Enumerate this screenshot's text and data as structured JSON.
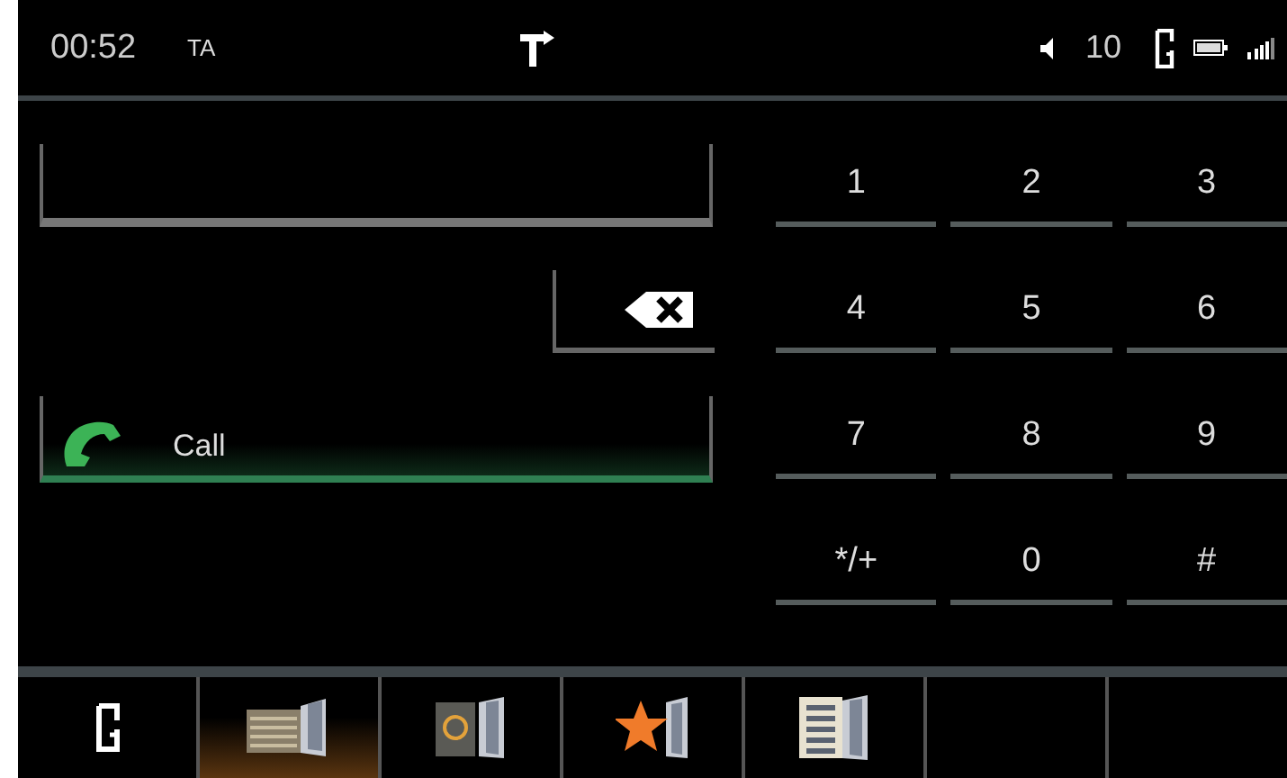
{
  "status_bar": {
    "time": "00:52",
    "traffic": "TA",
    "volume": "10"
  },
  "dialer": {
    "call_button": {
      "label": "Call"
    }
  },
  "keypad": [
    {
      "label": "1"
    },
    {
      "label": "2"
    },
    {
      "label": "3"
    },
    {
      "label": "4"
    },
    {
      "label": "5"
    },
    {
      "label": "6"
    },
    {
      "label": "7"
    },
    {
      "label": "8"
    },
    {
      "label": "9"
    },
    {
      "label": "*/+"
    },
    {
      "label": "0"
    },
    {
      "label": "#"
    }
  ],
  "bottom_tabs": [
    {
      "kind": "phone",
      "selected": false
    },
    {
      "kind": "call-list",
      "selected": true
    },
    {
      "kind": "contacts",
      "selected": false
    },
    {
      "kind": "favorites",
      "selected": false
    },
    {
      "kind": "menu",
      "selected": false
    },
    {
      "kind": "empty",
      "selected": false
    },
    {
      "kind": "empty",
      "selected": false
    }
  ]
}
